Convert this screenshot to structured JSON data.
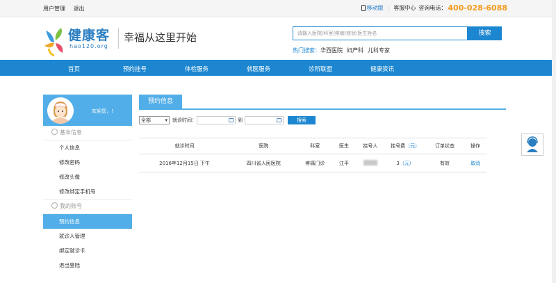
{
  "topbar": {
    "user_manage": "用户管理",
    "logout": "退出",
    "mobile": "移动版",
    "service_center": "客服中心",
    "hotline_label": "咨询电话：",
    "hotline": "400-028-6088"
  },
  "header": {
    "logo_text": "健康客",
    "logo_sub": "hao120.org",
    "slogan": "幸福从这里开始",
    "search_placeholder": "请输入医院/科室/疾病/症状/医生姓名",
    "search_button": "搜索",
    "hot_label": "热门搜索：",
    "hot_keywords": [
      "华西医院",
      "妇产科",
      "儿科专家"
    ]
  },
  "nav": [
    "首页",
    "预约挂号",
    "体检服务",
    "就医服务",
    "诊所联盟",
    "健康资讯"
  ],
  "sidebar": {
    "welcome": "欢迎您，!",
    "section_basic": "基本信息",
    "basic_items": [
      "个人信息",
      "修改密码",
      "修改头像",
      "修改绑定手机号"
    ],
    "section_account": "我的账号",
    "account_items": [
      "预约信息",
      "就诊人管理",
      "绑定就诊卡",
      "退出登陆"
    ]
  },
  "main": {
    "tab": "预约信息",
    "filter_select": "全部",
    "date_label": "就诊时间：",
    "to_label": "到",
    "query_button": "搜索",
    "columns": [
      "就诊时间",
      "医院",
      "科室",
      "医生",
      "挂号人",
      "挂号费",
      "（元）",
      "订单状态",
      "操作"
    ],
    "rows": [
      {
        "time": "2016年12月15日 下午",
        "hospital": "四川省人民医院",
        "dept": "疼痛门诊",
        "doctor": "江平",
        "fee": "3",
        "fee_unit": "（元）",
        "status": "有效",
        "action": "取消"
      }
    ]
  },
  "colors": {
    "primary": "#1c86d0",
    "sidebar_active": "#52aee8",
    "hotline": "#f39b21"
  }
}
